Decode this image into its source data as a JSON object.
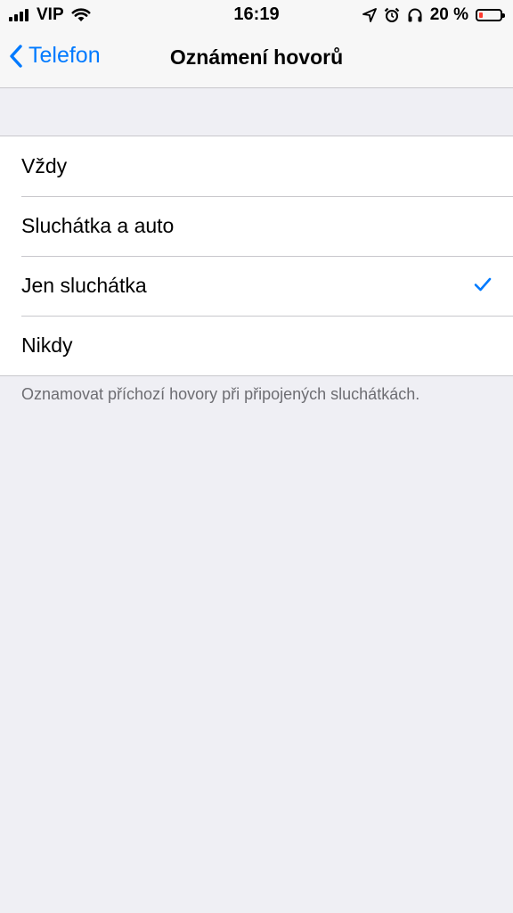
{
  "status_bar": {
    "carrier": "VIP",
    "time": "16:19",
    "battery_percent": "20 %",
    "battery_level": 0.2,
    "icons": [
      "signal-icon",
      "wifi-icon",
      "location-icon",
      "alarm-icon",
      "headphones-icon",
      "battery-icon"
    ]
  },
  "navbar": {
    "back_label": "Telefon",
    "title": "Oznámení hovorů"
  },
  "options": {
    "items": [
      {
        "label": "Vždy",
        "selected": false
      },
      {
        "label": "Sluchátka a auto",
        "selected": false
      },
      {
        "label": "Jen sluchátka",
        "selected": true
      },
      {
        "label": "Nikdy",
        "selected": false
      }
    ],
    "footer": "Oznamovat příchozí hovory při připojených sluchátkách."
  },
  "colors": {
    "accent": "#007aff",
    "background": "#efeff4",
    "battery_low": "#ff3b30"
  }
}
